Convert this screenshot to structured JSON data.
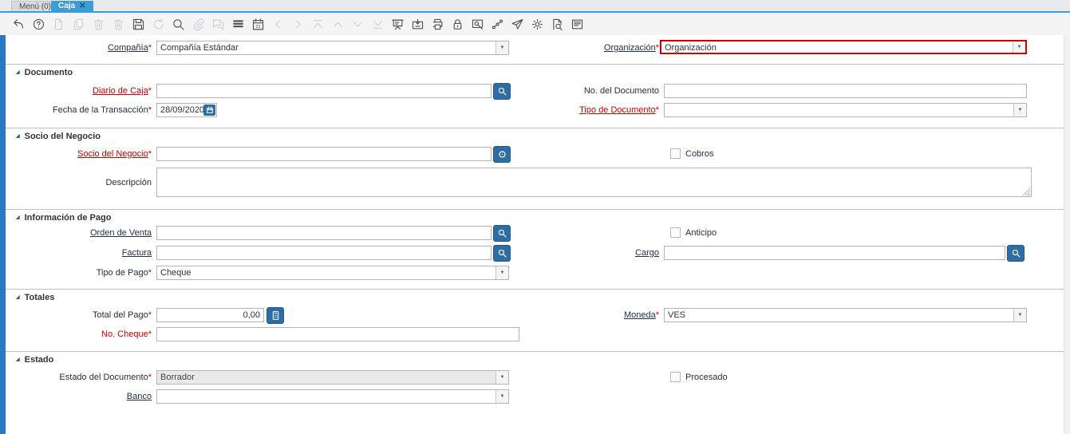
{
  "tabs": {
    "menu": "Menú (0)",
    "caja": "Caja",
    "close": "✕"
  },
  "toolbar": {
    "buttons": [
      {
        "name": "undo-icon",
        "enabled": true
      },
      {
        "name": "help-icon",
        "enabled": true
      },
      {
        "name": "new-record-icon",
        "enabled": false
      },
      {
        "name": "copy-record-icon",
        "enabled": false
      },
      {
        "name": "delete-record-icon",
        "enabled": false
      },
      {
        "name": "delete-selection-icon",
        "enabled": false
      },
      {
        "name": "save-icon",
        "enabled": true
      },
      {
        "name": "refresh-icon",
        "enabled": false
      },
      {
        "name": "find-icon",
        "enabled": true
      },
      {
        "name": "attachment-icon",
        "enabled": false
      },
      {
        "name": "chat-icon",
        "enabled": false
      },
      {
        "name": "grid-toggle-icon",
        "enabled": true
      },
      {
        "name": "history-icon",
        "enabled": true
      },
      {
        "name": "parent-record-icon",
        "enabled": false
      },
      {
        "name": "detail-record-icon",
        "enabled": false
      },
      {
        "name": "first-record-icon",
        "enabled": false
      },
      {
        "name": "previous-record-icon",
        "enabled": false
      },
      {
        "name": "next-record-icon",
        "enabled": false
      },
      {
        "name": "last-record-icon",
        "enabled": false
      },
      {
        "name": "report-icon",
        "enabled": true
      },
      {
        "name": "archive-icon",
        "enabled": true
      },
      {
        "name": "print-icon",
        "enabled": true
      },
      {
        "name": "lock-icon",
        "enabled": true
      },
      {
        "name": "print-preview-icon",
        "enabled": true
      },
      {
        "name": "workflow-icon",
        "enabled": true
      },
      {
        "name": "send-icon",
        "enabled": true
      },
      {
        "name": "process-icon",
        "enabled": true
      },
      {
        "name": "zoom-across-icon",
        "enabled": true
      },
      {
        "name": "window-help-icon",
        "enabled": true
      }
    ]
  },
  "form": {
    "compania": {
      "label": "Compañía",
      "required": "*",
      "value": "Compañía Estándar"
    },
    "organizacion": {
      "label": "Organización",
      "required": "*",
      "value": "Organización"
    },
    "sections": {
      "documento": {
        "title": "Documento"
      },
      "socio": {
        "title": "Socio del Negocio"
      },
      "info_pago": {
        "title": "Información de Pago"
      },
      "totales": {
        "title": "Totales"
      },
      "estado": {
        "title": "Estado"
      }
    },
    "diario_de_caja": {
      "label": "Diario de Caja",
      "required": "*",
      "value": ""
    },
    "no_del_documento": {
      "label": "No. del Documento",
      "value": ""
    },
    "fecha_de_la_transaccion": {
      "label": "Fecha de la Transacción",
      "required": "*",
      "value": "28/09/2020"
    },
    "tipo_de_documento": {
      "label": "Tipo de Documento",
      "required": "*",
      "value": ""
    },
    "socio_del_negocio": {
      "label": "Socio del Negocio",
      "required": "*",
      "value": ""
    },
    "cobros": {
      "label": "Cobros",
      "checked": false
    },
    "descripcion": {
      "label": "Descripción",
      "value": ""
    },
    "orden_de_venta": {
      "label": "Orden de Venta",
      "value": ""
    },
    "anticipo": {
      "label": "Anticipo",
      "checked": false
    },
    "factura": {
      "label": "Factura",
      "value": ""
    },
    "cargo": {
      "label": "Cargo",
      "value": ""
    },
    "tipo_de_pago": {
      "label": "Tipo de Pago",
      "required": "*",
      "value": "Cheque"
    },
    "total_del_pago": {
      "label": "Total del Pago",
      "required": "*",
      "value": "0,00"
    },
    "moneda": {
      "label": "Moneda",
      "required": "*",
      "value": "VES"
    },
    "no_cheque": {
      "label": "No. Cheque",
      "required": "*",
      "value": ""
    },
    "estado_del_documento": {
      "label": "Estado del Documento",
      "required": "*",
      "value": "Borrador"
    },
    "procesado": {
      "label": "Procesado",
      "checked": false
    },
    "banco": {
      "label": "Banco",
      "value": ""
    }
  },
  "colors": {
    "accent_blue": "#3d9bd5",
    "leftbar_blue": "#2779c4",
    "field_button_blue": "#2e6da4",
    "required_red": "#cc0000",
    "highlight_border_red": "#cc0000",
    "readonly_gray": "#e9e9e9"
  }
}
